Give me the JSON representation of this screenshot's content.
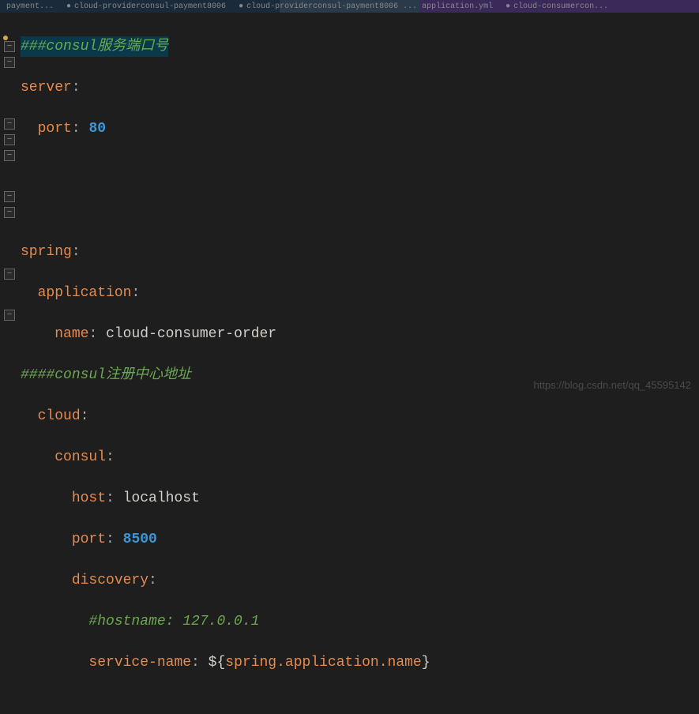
{
  "tabs": {
    "tab1_text": "payment...",
    "tab2_text": "cloud-providerconsul-payment8006",
    "tab3_text": "cloud-providerconsul-payment8006 ... application.yml",
    "tab4_text": "cloud-consumercon..."
  },
  "code": {
    "comment1_hash": "###",
    "comment1_word": "consul",
    "comment1_rest": "服务端口号",
    "server_key": "server",
    "port_key": "port",
    "server_port": "80",
    "spring_key": "spring",
    "application_key": "application",
    "name_key": "name",
    "app_name": "cloud-consumer-order",
    "comment2_hash": "####",
    "comment2_word": "consul",
    "comment2_rest": "注册中心地址",
    "cloud_key": "cloud",
    "consul_key": "consul",
    "host_key": "host",
    "host_val": "localhost",
    "consul_port": "8500",
    "discovery_key": "discovery",
    "comment3": "#hostname: 127.0.0.1",
    "service_name_key": "service-name",
    "dollar": "$",
    "lbrace": "{",
    "var_expr": "spring.application.name",
    "rbrace": "}"
  },
  "watermark": "https://blog.csdn.net/qq_45595142"
}
